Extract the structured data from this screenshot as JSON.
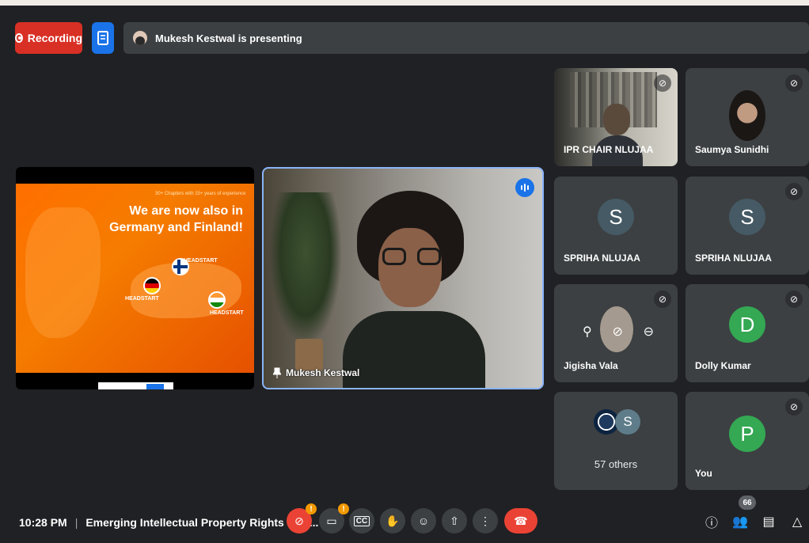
{
  "top": {
    "recording_label": "Recording",
    "presenting_text": "Mukesh Kestwal is presenting"
  },
  "slide": {
    "small_text": "30+ Chapters with 15+ years of experience",
    "title_line1": "We are now also in",
    "title_line2": "Germany and Finland!",
    "badges": [
      "HEADSTART",
      "HEADSTART",
      "HEADSTART"
    ]
  },
  "presenter": {
    "name": "Mukesh Kestwal"
  },
  "participants": [
    {
      "name": "IPR CHAIR NLUJAA",
      "type": "video",
      "muted": true
    },
    {
      "name": "Saumya Sunidhi",
      "type": "photo",
      "muted": true
    },
    {
      "name": "SPRIHA NLUJAA",
      "letter": "S",
      "color": "#455a64",
      "muted": false
    },
    {
      "name": "SPRIHA NLUJAA",
      "letter": "S",
      "color": "#455a64",
      "muted": true
    },
    {
      "name": "Jigisha Vala",
      "type": "photo",
      "muted": true
    },
    {
      "name": "Dolly Kumar",
      "letter": "D",
      "color": "#34a853",
      "muted": true
    },
    {
      "name": "57 others",
      "letter": "S",
      "type": "group"
    },
    {
      "name": "You",
      "letter": "P",
      "color": "#34a853",
      "muted": true
    }
  ],
  "bottom": {
    "time": "10:28 PM",
    "separator": "|",
    "meeting_title": "Emerging Intellectual Property Rights Issu...",
    "people_count": "66"
  },
  "icons": {
    "recording": "record-icon",
    "document": "doc-icon",
    "mic": "mic-off-icon",
    "camera": "camera-off-icon",
    "captions": "cc-icon",
    "hand": "raise-hand-icon",
    "emoji": "emoji-icon",
    "present": "present-icon",
    "more": "more-vert-icon",
    "hangup": "hangup-icon",
    "info": "info-icon",
    "people": "people-icon",
    "chat": "chat-icon",
    "activities": "activities-icon"
  },
  "colors": {
    "background": "#202124",
    "tile": "#3c4043",
    "recording": "#d93025",
    "accent": "#1a73e8",
    "danger": "#ea4335",
    "warning": "#f29900"
  }
}
